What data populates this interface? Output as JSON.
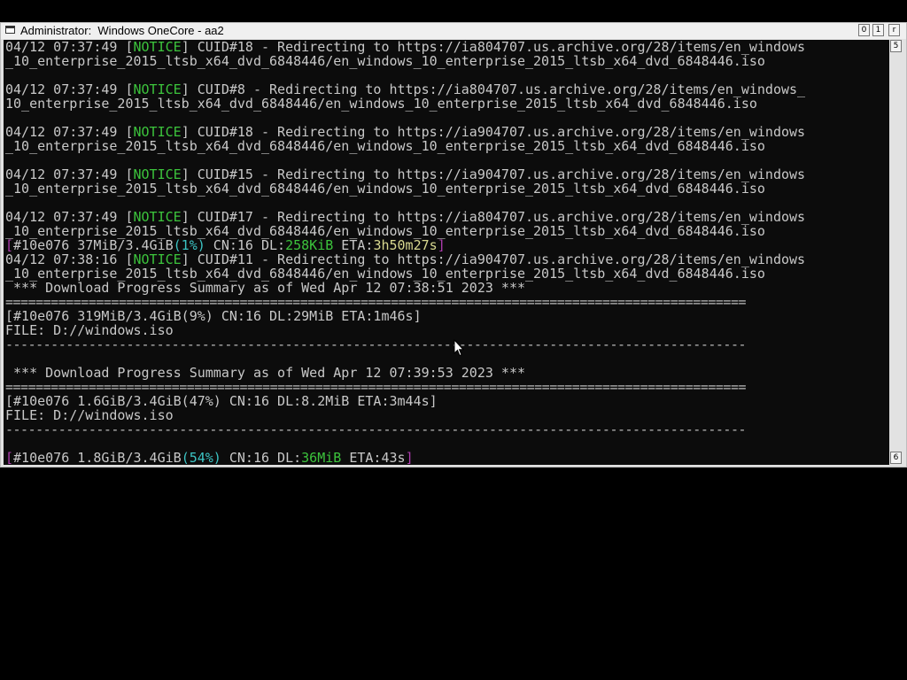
{
  "window": {
    "title": "Administrator:  Windows OneCore - aa2",
    "controls": {
      "minimize": "0",
      "maximize": "1",
      "close": "r"
    },
    "scrollbar": {
      "up": "5",
      "down": "6"
    }
  },
  "console": {
    "lines": [
      [
        {
          "t": "04/12 07:37:49 ["
        },
        {
          "t": "NOTICE",
          "c": "g"
        },
        {
          "t": "] CUID#18 - Redirecting to https://ia804707.us.archive.org/28/items/en_windows"
        }
      ],
      [
        {
          "t": "_10_enterprise_2015_ltsb_x64_dvd_6848446/en_windows_10_enterprise_2015_ltsb_x64_dvd_6848446.iso"
        }
      ],
      [],
      [
        {
          "t": "04/12 07:37:49 ["
        },
        {
          "t": "NOTICE",
          "c": "g"
        },
        {
          "t": "] CUID#8 - Redirecting to https://ia804707.us.archive.org/28/items/en_windows_"
        }
      ],
      [
        {
          "t": "10_enterprise_2015_ltsb_x64_dvd_6848446/en_windows_10_enterprise_2015_ltsb_x64_dvd_6848446.iso"
        }
      ],
      [],
      [
        {
          "t": "04/12 07:37:49 ["
        },
        {
          "t": "NOTICE",
          "c": "g"
        },
        {
          "t": "] CUID#18 - Redirecting to https://ia904707.us.archive.org/28/items/en_windows"
        }
      ],
      [
        {
          "t": "_10_enterprise_2015_ltsb_x64_dvd_6848446/en_windows_10_enterprise_2015_ltsb_x64_dvd_6848446.iso"
        }
      ],
      [],
      [
        {
          "t": "04/12 07:37:49 ["
        },
        {
          "t": "NOTICE",
          "c": "g"
        },
        {
          "t": "] CUID#15 - Redirecting to https://ia904707.us.archive.org/28/items/en_windows"
        }
      ],
      [
        {
          "t": "_10_enterprise_2015_ltsb_x64_dvd_6848446/en_windows_10_enterprise_2015_ltsb_x64_dvd_6848446.iso"
        }
      ],
      [],
      [
        {
          "t": "04/12 07:37:49 ["
        },
        {
          "t": "NOTICE",
          "c": "g"
        },
        {
          "t": "] CUID#17 - Redirecting to https://ia804707.us.archive.org/28/items/en_windows"
        }
      ],
      [
        {
          "t": "_10_enterprise_2015_ltsb_x64_dvd_6848446/en_windows_10_enterprise_2015_ltsb_x64_dvd_6848446.iso"
        }
      ],
      [
        {
          "t": "[",
          "c": "m"
        },
        {
          "t": "#10e076 37MiB/3.4GiB"
        },
        {
          "t": "(1%)",
          "c": "c"
        },
        {
          "t": " CN:16 DL:"
        },
        {
          "t": "258KiB",
          "c": "g"
        },
        {
          "t": " ETA:"
        },
        {
          "t": "3h50m27s",
          "c": "y"
        },
        {
          "t": "]",
          "c": "m"
        }
      ],
      [
        {
          "t": "04/12 07:38:16 ["
        },
        {
          "t": "NOTICE",
          "c": "g"
        },
        {
          "t": "] CUID#11 - Redirecting to https://ia904707.us.archive.org/28/items/en_windows"
        }
      ],
      [
        {
          "t": "_10_enterprise_2015_ltsb_x64_dvd_6848446/en_windows_10_enterprise_2015_ltsb_x64_dvd_6848446.iso"
        }
      ],
      [
        {
          "t": " *** Download Progress Summary as of Wed Apr 12 07:38:51 2023 ***"
        }
      ],
      [
        {
          "t": "==================================================================================================",
          "c": "sep"
        }
      ],
      [
        {
          "t": "[#10e076 319MiB/3.4GiB(9%) CN:16 DL:29MiB ETA:1m46s]"
        }
      ],
      [
        {
          "t": "FILE: D://windows.iso"
        }
      ],
      [
        {
          "t": "--------------------------------------------------------------------------------------------------",
          "c": "sep"
        }
      ],
      [],
      [
        {
          "t": " *** Download Progress Summary as of Wed Apr 12 07:39:53 2023 ***"
        }
      ],
      [
        {
          "t": "==================================================================================================",
          "c": "sep"
        }
      ],
      [
        {
          "t": "[#10e076 1.6GiB/3.4GiB(47%) CN:16 DL:8.2MiB ETA:3m44s]"
        }
      ],
      [
        {
          "t": "FILE: D://windows.iso"
        }
      ],
      [
        {
          "t": "--------------------------------------------------------------------------------------------------",
          "c": "sep"
        }
      ],
      [],
      [
        {
          "t": "[",
          "c": "m"
        },
        {
          "t": "#10e076 1.8GiB/3.4GiB"
        },
        {
          "t": "(54%)",
          "c": "c"
        },
        {
          "t": " CN:16 DL:"
        },
        {
          "t": "36MiB",
          "c": "g"
        },
        {
          "t": " ETA:43s"
        },
        {
          "t": "]",
          "c": "m"
        }
      ]
    ]
  }
}
